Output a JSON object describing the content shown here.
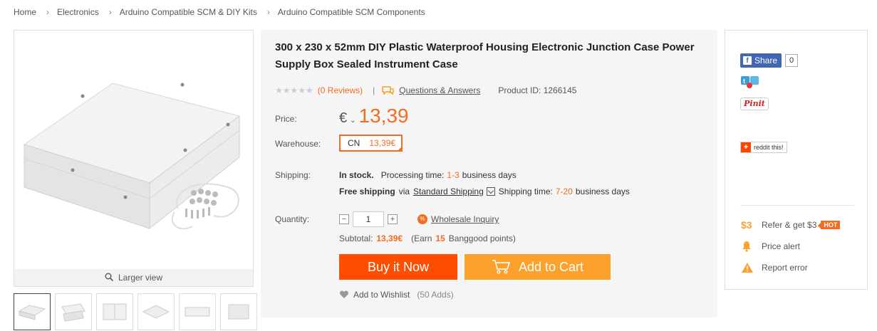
{
  "breadcrumb": [
    "Home",
    "Electronics",
    "Arduino Compatible SCM & DIY Kits",
    "Arduino Compatible SCM Components"
  ],
  "gallery": {
    "larger_view": "Larger view",
    "thumb_count": 6
  },
  "product": {
    "title": "300 x 230 x 52mm DIY Plastic Waterproof Housing Electronic Junction Case Power Supply Box Sealed Instrument Case",
    "rating_stars": 0,
    "reviews": "(0 Reviews)",
    "separator": "|",
    "questions": "Questions & Answers",
    "product_id": "Product ID: 1266145",
    "price_label": "Price:",
    "currency": "€",
    "price": "13,39",
    "warehouse_label": "Warehouse:",
    "warehouse_code": "CN",
    "warehouse_price": "13,39€",
    "shipping_label": "Shipping:",
    "in_stock": "In stock.",
    "processing_text": "Processing time:",
    "processing_range": "1-3",
    "processing_unit": "business days",
    "free_shipping": "Free shipping",
    "via": "via",
    "shipping_method": "Standard Shipping",
    "shipping_time_text": "Shipping time:",
    "shipping_range": "7-20",
    "shipping_unit": "business days",
    "quantity_label": "Quantity:",
    "quantity": "1",
    "wholesale": "Wholesale Inquiry",
    "subtotal_label": "Subtotal:",
    "subtotal": "13,39€",
    "earn_prefix": "(Earn",
    "earn_points": "15",
    "earn_suffix": "Banggood points)",
    "buy_now": "Buy it Now",
    "add_to_cart": "Add to Cart",
    "wishlist": "Add to Wishlist",
    "wishlist_adds": "(50 Adds)"
  },
  "sidebar": {
    "share": "Share",
    "share_count": "0",
    "pinit": "Pinit",
    "reddit": "reddit this!",
    "refer_icon": "$3",
    "refer": "Refer & get $3",
    "hot": "HOT",
    "price_alert": "Price alert",
    "report_error": "Report error"
  },
  "colors": {
    "accent": "#f36c21",
    "buy": "#ff4e00",
    "cart": "#fca12b",
    "facebook": "#4267b2"
  }
}
